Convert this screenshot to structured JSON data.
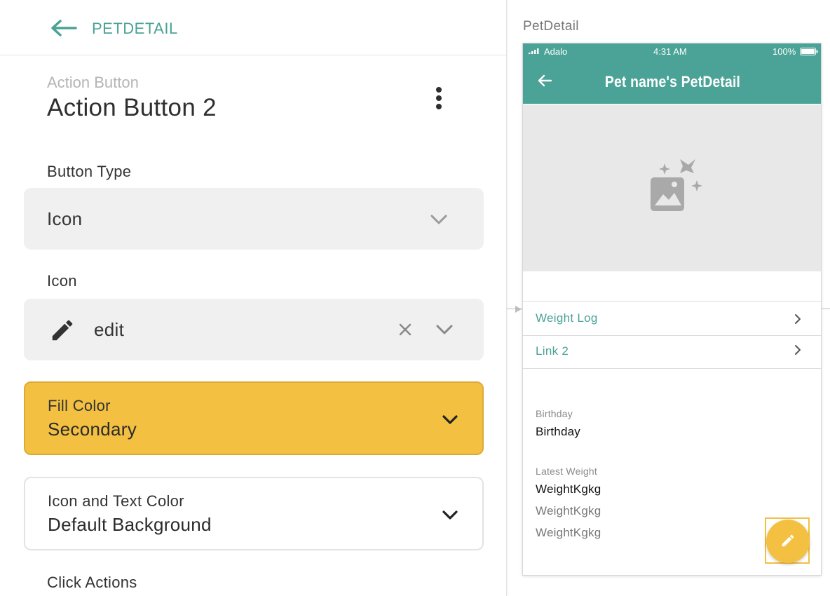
{
  "panel": {
    "back_title": "PETDETAIL",
    "component_kind": "Action Button",
    "component_name": "Action Button 2"
  },
  "button_type": {
    "label": "Button Type",
    "value": "Icon"
  },
  "icon_field": {
    "label": "Icon",
    "value": "edit",
    "icon": "edit-pencil-icon"
  },
  "fill_color": {
    "label": "Fill Color",
    "value": "Secondary",
    "color": "#f3c041"
  },
  "text_color": {
    "label": "Icon and Text Color",
    "value": "Default Background"
  },
  "click_actions": {
    "label": "Click Actions"
  },
  "preview": {
    "screen_name": "PetDetail",
    "status": {
      "carrier": "Adalo",
      "time": "4:31 AM",
      "battery": "100%"
    },
    "title": "Pet name's PetDetail",
    "links": [
      "Weight Log",
      "Link 2"
    ],
    "birthday": {
      "label": "Birthday",
      "value": "Birthday"
    },
    "latest_weight": {
      "label": "Latest Weight",
      "values": [
        "WeightKgkg",
        "WeightKgkg",
        "WeightKgkg"
      ]
    }
  },
  "colors": {
    "primary": "#4aa396",
    "secondary": "#f3c041"
  }
}
